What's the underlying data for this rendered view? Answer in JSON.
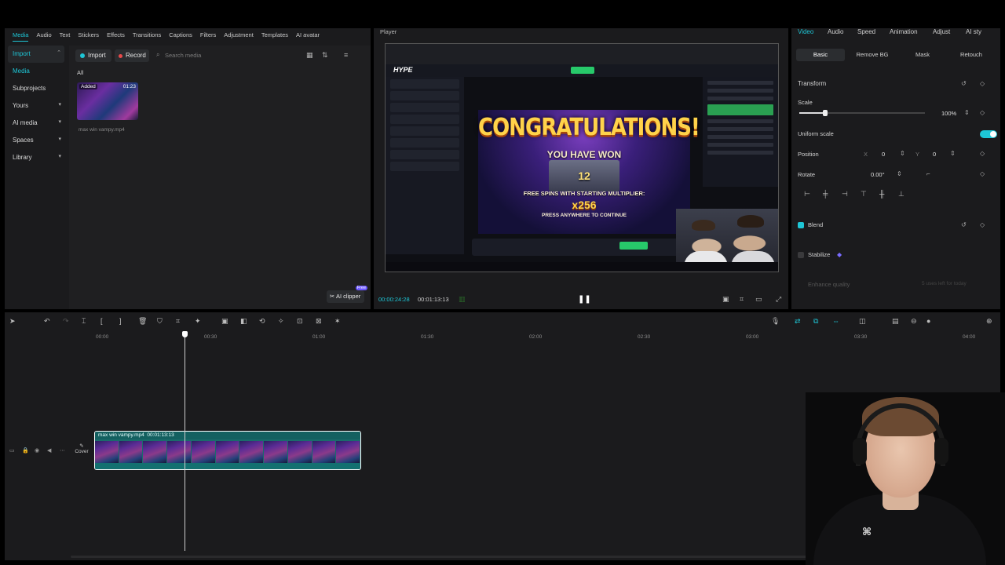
{
  "left_panel": {
    "tabs": [
      "Media",
      "Audio",
      "Text",
      "Stickers",
      "Effects",
      "Transitions",
      "Captions",
      "Filters",
      "Adjustment",
      "Templates",
      "AI avatar"
    ],
    "nav": [
      "Import",
      "Media",
      "Subprojects",
      "Yours",
      "AI media",
      "Spaces",
      "Library"
    ],
    "import_label": "Import",
    "record_label": "Record",
    "search_placeholder": "Search media",
    "filter_all": "All",
    "thumb_added": "Added",
    "thumb_duration": "01:23",
    "thumb_name": "max win vampy.mp4",
    "ai_clipper": "AI clipper",
    "ai_clipper_badge": "Free"
  },
  "player": {
    "title": "Player",
    "current_time": "00:00:24:28",
    "total_time": "00:01:13:13",
    "screen": {
      "logo": "HYPE",
      "congrats": "CONGRATULATIONS!",
      "you_have_won": "YOU HAVE WON",
      "won_count": "12",
      "free_spins": "FREE SPINS WITH STARTING MULTIPLIER:",
      "multiplier": "x256",
      "press": "PRESS ANYWHERE TO CONTINUE"
    }
  },
  "inspector": {
    "tabs": [
      "Video",
      "Audio",
      "Speed",
      "Animation",
      "Adjust",
      "AI sty"
    ],
    "subtabs": [
      "Basic",
      "Remove BG",
      "Mask",
      "Retouch"
    ],
    "transform": "Transform",
    "scale_label": "Scale",
    "scale_value": "100%",
    "uniform_scale": "Uniform scale",
    "position_label": "Position",
    "pos_x_label": "X",
    "pos_x": "0",
    "pos_y_label": "Y",
    "pos_y": "0",
    "rotate_label": "Rotate",
    "rotate_value": "0.00°",
    "blend": "Blend",
    "stabilize": "Stabilize",
    "enhance_quality": "Enhance quality",
    "enhance_note": "5 uses left for today",
    "accent": "#1ec6d6"
  },
  "timeline": {
    "ticks": [
      "00:00",
      "00:30",
      "01:00",
      "01:30",
      "02:00",
      "02:30",
      "03:00",
      "03:30",
      "04:00"
    ],
    "clip_name": "max win vampy.mp4",
    "clip_duration": "00:01:13:13",
    "cover_label": "Cover"
  }
}
